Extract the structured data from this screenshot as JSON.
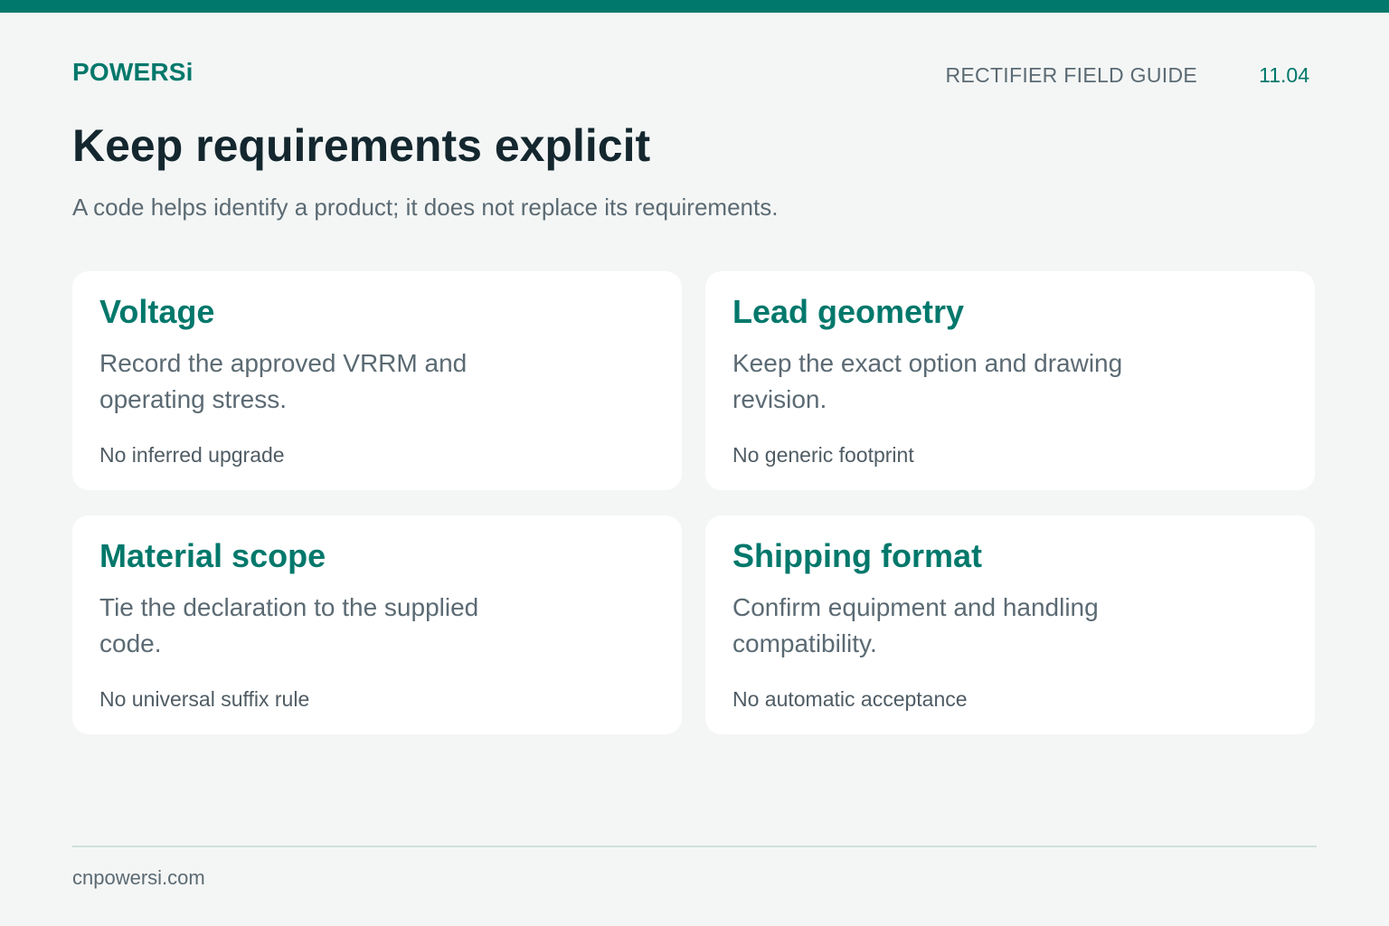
{
  "header": {
    "brand": "POWERSi",
    "guide_label": "RECTIFIER FIELD GUIDE",
    "page_number": "11.04"
  },
  "main": {
    "title": "Keep requirements explicit",
    "subtitle": "A code helps identify a product; it does not replace its requirements.",
    "cards": [
      {
        "title": "Voltage",
        "body": "Record the approved VRRM and operating stress.",
        "note": "No inferred upgrade"
      },
      {
        "title": "Lead geometry",
        "body": "Keep the exact option and drawing revision.",
        "note": "No generic footprint"
      },
      {
        "title": "Material scope",
        "body": "Tie the declaration to the supplied code.",
        "note": "No universal suffix rule"
      },
      {
        "title": "Shipping format",
        "body": "Confirm equipment and handling compatibility.",
        "note": "No automatic acceptance"
      }
    ]
  },
  "footer": {
    "website": "cnpowersi.com"
  },
  "colors": {
    "accent": "#00786b",
    "background": "#f4f6f5",
    "card": "#ffffff",
    "title_text": "#14272f",
    "muted_text": "#5b6a73"
  }
}
